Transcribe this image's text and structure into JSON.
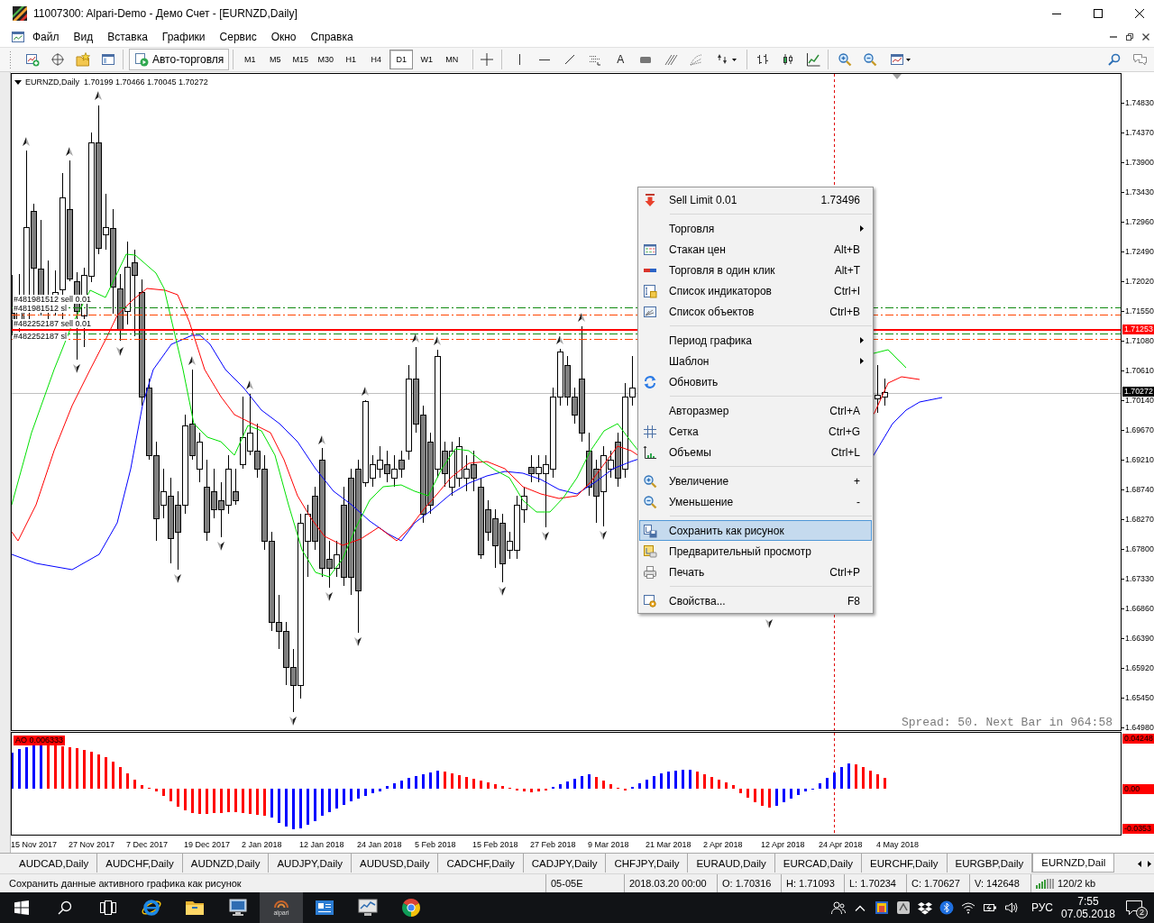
{
  "window": {
    "title": "11007300: Alpari-Demo - Демо Счет - [EURNZD,Daily]"
  },
  "menu_bar": {
    "items": [
      "Файл",
      "Вид",
      "Вставка",
      "Графики",
      "Сервис",
      "Окно",
      "Справка"
    ]
  },
  "toolbar": {
    "auto_trading": "Авто-торговля",
    "timeframes": [
      {
        "label": "M1",
        "selected": false
      },
      {
        "label": "M5",
        "selected": false
      },
      {
        "label": "M15",
        "selected": false
      },
      {
        "label": "M30",
        "selected": false
      },
      {
        "label": "H1",
        "selected": false
      },
      {
        "label": "H4",
        "selected": false
      },
      {
        "label": "D1",
        "selected": true
      },
      {
        "label": "W1",
        "selected": false
      },
      {
        "label": "MN",
        "selected": false
      }
    ],
    "text_tool": "A"
  },
  "chart": {
    "header": "EURNZD,Daily  1.70199 1.70466 1.70045 1.70272",
    "trade_labels": [
      "#481981512 sell 0.01",
      "#481981512 sl",
      "#482252187 sell 0.01",
      "#482252187 sl"
    ],
    "spread_info": "Spread: 50. Next Bar in 964:58",
    "price_axis": {
      "ticks": [
        "1.74830",
        "1.74370",
        "1.73900",
        "1.73430",
        "1.72960",
        "1.72490",
        "1.72020",
        "1.71550",
        "1.71080",
        "1.70610",
        "1.70140",
        "1.69670",
        "1.69210",
        "1.68740",
        "1.68270",
        "1.67800",
        "1.67330",
        "1.66860",
        "1.66390",
        "1.65920",
        "1.65450",
        "1.64980"
      ],
      "markers": [
        {
          "kind": "line",
          "value": "1.71253"
        },
        {
          "kind": "bid",
          "value": "1.70272"
        }
      ]
    },
    "indicator": {
      "label": "AO 0.006333",
      "axis_labels": [
        "0.04248",
        "0.00",
        "-0.0353"
      ]
    },
    "time_axis": {
      "labels": [
        "15 Nov 2017",
        "27 Nov 2017",
        "7 Dec 2017",
        "19 Dec 2017",
        "2 Jan 2018",
        "12 Jan 2018",
        "24 Jan 2018",
        "5 Feb 2018",
        "15 Feb 2018",
        "27 Feb 2018",
        "9 Mar 2018",
        "21 Mar 2018",
        "2 Apr 2018",
        "12 Apr 2018",
        "24 Apr 2018",
        "4 May 2018"
      ]
    }
  },
  "context_menu": {
    "items": [
      {
        "kind": "item",
        "label": "Sell Limit 0.01",
        "value": "1.73496",
        "submenu": false,
        "selected": false
      },
      {
        "kind": "separator"
      },
      {
        "kind": "item",
        "label": "Торговля",
        "submenu": true,
        "selected": false
      },
      {
        "kind": "item",
        "label": "Стакан цен",
        "shortcut": "Alt+B",
        "submenu": false,
        "selected": false
      },
      {
        "kind": "item",
        "label": "Торговля в один клик",
        "shortcut": "Alt+T",
        "submenu": false,
        "selected": false
      },
      {
        "kind": "item",
        "label": "Список индикаторов",
        "shortcut": "Ctrl+I",
        "submenu": false,
        "selected": false
      },
      {
        "kind": "item",
        "label": "Список объектов",
        "shortcut": "Ctrl+B",
        "submenu": false,
        "selected": false
      },
      {
        "kind": "separator"
      },
      {
        "kind": "item",
        "label": "Период графика",
        "submenu": true,
        "selected": false
      },
      {
        "kind": "item",
        "label": "Шаблон",
        "submenu": true,
        "selected": false
      },
      {
        "kind": "item",
        "label": "Обновить",
        "submenu": false,
        "selected": false
      },
      {
        "kind": "separator"
      },
      {
        "kind": "item",
        "label": "Авторазмер",
        "shortcut": "Ctrl+A",
        "submenu": false,
        "selected": false
      },
      {
        "kind": "item",
        "label": "Сетка",
        "shortcut": "Ctrl+G",
        "submenu": false,
        "selected": false
      },
      {
        "kind": "item",
        "label": "Объемы",
        "shortcut": "Ctrl+L",
        "submenu": false,
        "selected": false
      },
      {
        "kind": "separator"
      },
      {
        "kind": "item",
        "label": "Увеличение",
        "shortcut": "+",
        "submenu": false,
        "selected": false
      },
      {
        "kind": "item",
        "label": "Уменьшение",
        "shortcut": "-",
        "submenu": false,
        "selected": false
      },
      {
        "kind": "separator"
      },
      {
        "kind": "item",
        "label": "Сохранить как рисунок",
        "submenu": false,
        "selected": true
      },
      {
        "kind": "item",
        "label": "Предварительный просмотр",
        "submenu": false,
        "selected": false
      },
      {
        "kind": "item",
        "label": "Печать",
        "shortcut": "Ctrl+P",
        "submenu": false,
        "selected": false
      },
      {
        "kind": "separator"
      },
      {
        "kind": "item",
        "label": "Свойства...",
        "shortcut": "F8",
        "submenu": false,
        "selected": false
      }
    ]
  },
  "tabs": [
    {
      "label": "AUDCAD,Daily",
      "selected": false
    },
    {
      "label": "AUDCHF,Daily",
      "selected": false
    },
    {
      "label": "AUDNZD,Daily",
      "selected": false
    },
    {
      "label": "AUDJPY,Daily",
      "selected": false
    },
    {
      "label": "AUDUSD,Daily",
      "selected": false
    },
    {
      "label": "CADCHF,Daily",
      "selected": false
    },
    {
      "label": "CADJPY,Daily",
      "selected": false
    },
    {
      "label": "CHFJPY,Daily",
      "selected": false
    },
    {
      "label": "EURAUD,Daily",
      "selected": false
    },
    {
      "label": "EURCAD,Daily",
      "selected": false
    },
    {
      "label": "EURCHF,Daily",
      "selected": false
    },
    {
      "label": "EURGBP,Daily",
      "selected": false
    },
    {
      "label": "EURNZD,Dail",
      "selected": true
    }
  ],
  "status_bar": {
    "message": "Сохранить данные активного графика как рисунок",
    "fields": [
      "05-05E",
      "2018.03.20 00:00",
      "O: 1.70316",
      "H: 1.71093",
      "L: 1.70234",
      "C: 1.70627",
      "V: 142648",
      "120/2 kb"
    ]
  },
  "taskbar": {
    "apps": [
      {
        "selected": false
      },
      {
        "selected": false
      },
      {
        "selected": false
      },
      {
        "label": "alpari",
        "selected": true
      },
      {
        "selected": false
      },
      {
        "selected": false
      },
      {
        "selected": false
      }
    ],
    "tray": {
      "language": "РУС",
      "time": "7:55",
      "date": "07.05.2018",
      "notifications": "2"
    }
  }
}
